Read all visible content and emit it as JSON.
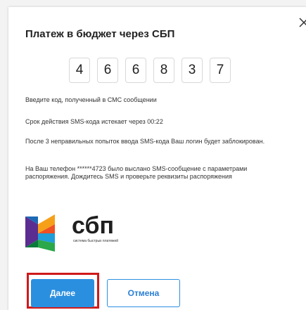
{
  "dialog": {
    "title": "Платеж в бюджет через СБП",
    "close_icon": "close-icon"
  },
  "code": {
    "digits": [
      "4",
      "6",
      "6",
      "8",
      "3",
      "7"
    ]
  },
  "messages": {
    "enter_code": "Введите код, полученный в СМС сообщении",
    "expiry": "Срок действия SMS-кода истекает через 00:22",
    "attempts_warning": "После 3 неправильных попыток ввода SMS-кода Ваш логин будет заблокирован.",
    "sms_sent": "На Ваш телефон ******4723 было выслано SMS-сообщение с параметрами распоряжения. Дождитесь SMS и проверьте реквизиты распоряжения"
  },
  "logo": {
    "name": "сбп",
    "subtitle": "система быстрых платежей",
    "icon": "sbp-logo-icon"
  },
  "buttons": {
    "next": "Далее",
    "cancel": "Отмена"
  },
  "colors": {
    "accent": "#2b8fe0",
    "highlight": "#d11919"
  }
}
